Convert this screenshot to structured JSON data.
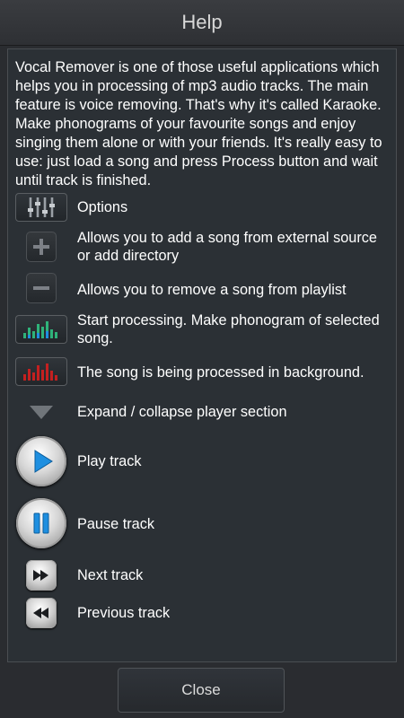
{
  "header": {
    "title": "Help"
  },
  "intro": "Vocal Remover is one of those useful applications which helps you in processing of mp3 audio tracks. The main feature is voice removing. That's why it's called Karaoke. Make phonograms of your favourite songs and enjoy singing them alone or with your friends. It's really easy to use: just load a song and press Process button and wait until track is finished.",
  "items": [
    {
      "icon": "equalizer-options-icon",
      "text": "Options"
    },
    {
      "icon": "plus-icon",
      "text": "Allows you to add a song from external source or add directory"
    },
    {
      "icon": "minus-icon",
      "text": "Allows you to remove a song from playlist"
    },
    {
      "icon": "spectrum-start-icon",
      "text": "Start processing. Make phonogram of selected song."
    },
    {
      "icon": "spectrum-processing-icon",
      "text": "The song is being processed in background."
    },
    {
      "icon": "triangle-down-icon",
      "text": "Expand / collapse player section"
    },
    {
      "icon": "play-icon",
      "text": "Play track"
    },
    {
      "icon": "pause-icon",
      "text": "Pause track"
    },
    {
      "icon": "next-track-icon",
      "text": "Next track"
    },
    {
      "icon": "previous-track-icon",
      "text": "Previous track"
    }
  ],
  "footer": {
    "close_label": "Close"
  },
  "colors": {
    "background": "#2a2c30",
    "panel": "#2b3035",
    "accent_blue": "#1e8fe0",
    "spectrum_green": "#2fb37a",
    "spectrum_red": "#c42020"
  }
}
